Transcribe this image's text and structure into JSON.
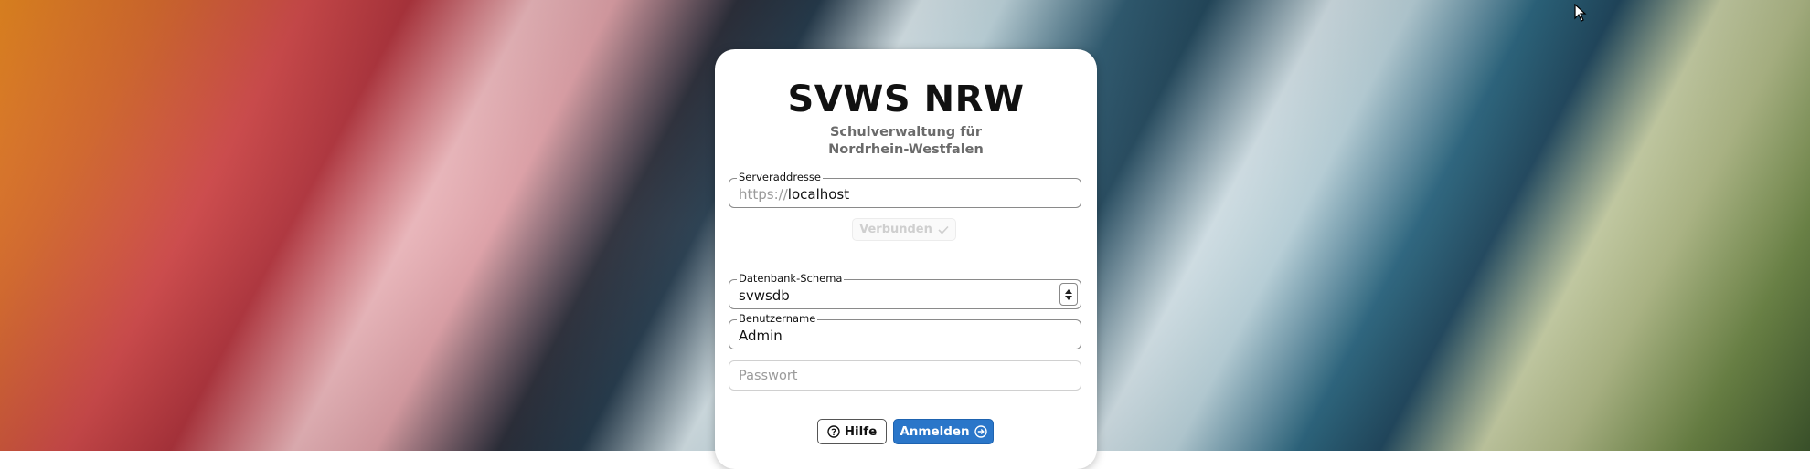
{
  "app": {
    "title": "SVWS NRW",
    "subtitle_line1": "Schulverwaltung für",
    "subtitle_line2": "Nordrhein-Westfalen"
  },
  "server": {
    "label": "Serveraddresse",
    "prefix": "https://",
    "value": "localhost"
  },
  "connect_button": {
    "label": "Verbunden",
    "icon": "check-icon"
  },
  "schema": {
    "label": "Datenbank-Schema",
    "value": "svwsdb"
  },
  "username": {
    "label": "Benutzername",
    "value": "Admin"
  },
  "password": {
    "placeholder": "Passwort"
  },
  "buttons": {
    "help_label": "Hilfe",
    "login_label": "Anmelden"
  },
  "colors": {
    "primary": "#2a76c9",
    "card": "#ffffff"
  }
}
